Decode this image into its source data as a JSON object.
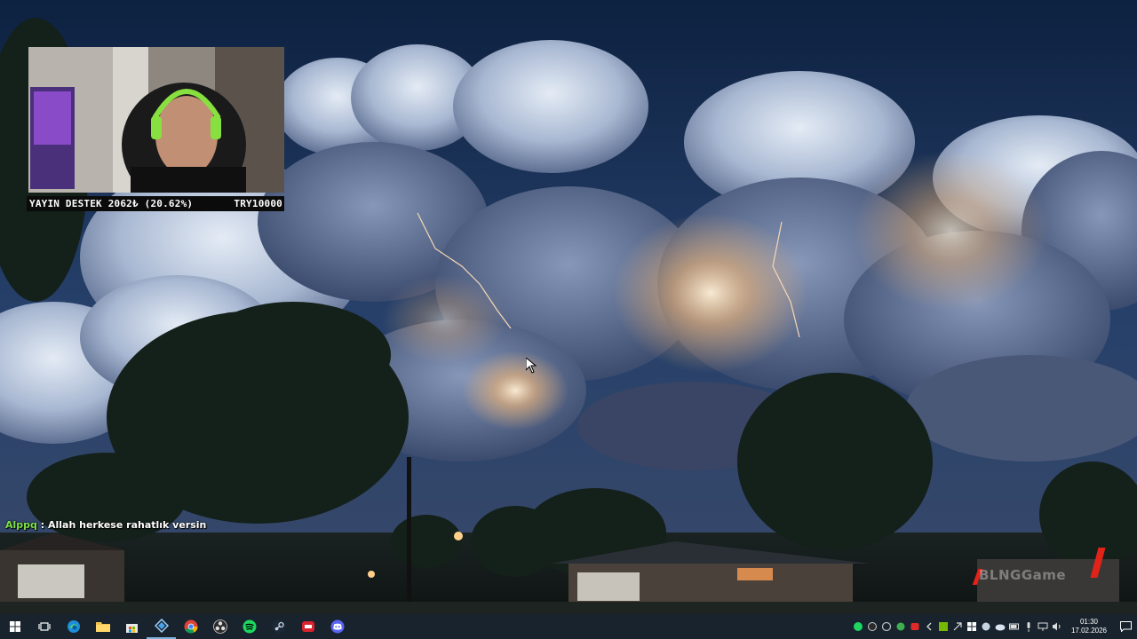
{
  "overlay": {
    "donation_label": "YAYIN DESTEK 2062₺ (20.62%)",
    "donation_goal": "TRY10000",
    "donation_progress_percent": 20.62
  },
  "chat": {
    "username": "Alppq",
    "separator": " : ",
    "message": "Allah herkese rahatlık versin"
  },
  "watermark": {
    "text": "BLNGGame"
  },
  "taskbar": {
    "pinned_apps": [
      {
        "name": "start",
        "icon": "windows-icon"
      },
      {
        "name": "task-view",
        "icon": "task-view-icon"
      },
      {
        "name": "edge",
        "icon": "edge-icon"
      },
      {
        "name": "file-explorer",
        "icon": "folder-icon"
      },
      {
        "name": "store",
        "icon": "store-icon"
      },
      {
        "name": "app",
        "icon": "app-icon"
      },
      {
        "name": "chrome",
        "icon": "chrome-icon"
      },
      {
        "name": "obs",
        "icon": "obs-icon"
      },
      {
        "name": "spotify",
        "icon": "spotify-icon"
      },
      {
        "name": "steam",
        "icon": "steam-icon"
      },
      {
        "name": "game",
        "icon": "game-icon"
      },
      {
        "name": "discord",
        "icon": "discord-icon"
      }
    ],
    "clock": {
      "time": "01:30",
      "date": "17.02.2026"
    }
  },
  "colors": {
    "taskbar_bg": "#18232d",
    "chat_username": "#7ee04a",
    "watermark_accent": "#e2231a"
  }
}
